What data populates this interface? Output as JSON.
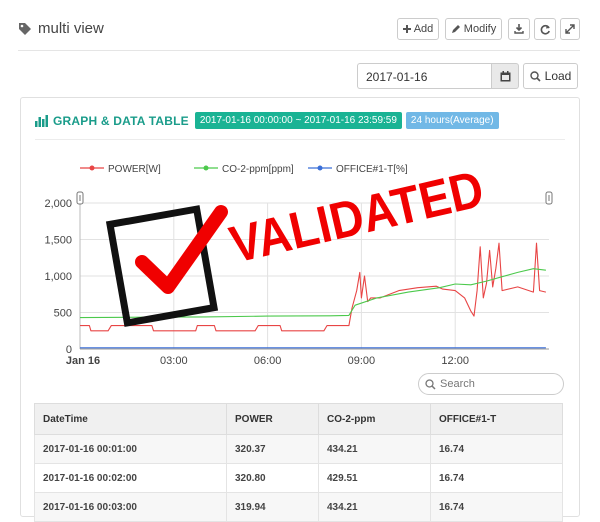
{
  "header": {
    "title": "multi view",
    "add_label": "Add",
    "modify_label": "Modify"
  },
  "toolbar": {
    "date_value": "2017-01-16",
    "load_label": "Load"
  },
  "panel": {
    "title": "GRAPH & DATA TABLE",
    "range_badge": "2017-01-16 00:00:00 ~ 2017-01-16 23:59:59",
    "mode_badge": "24 hours(Average)"
  },
  "search": {
    "placeholder": "Search"
  },
  "stamp": {
    "text": "VALIDATED"
  },
  "colors": {
    "accent": "#1ab394",
    "badge_blue": "#71b8e6",
    "power": "#e84545",
    "co2": "#4cc94c",
    "office": "#3a6fd8",
    "stamp": "#f00000"
  },
  "chart_data": {
    "type": "line",
    "legend": [
      "POWER[W]",
      "CO-2-ppm[ppm]",
      "OFFICE#1-T[%]"
    ],
    "x_ticks": [
      "Jan 16",
      "03:00",
      "06:00",
      "09:00",
      "12:00"
    ],
    "y_ticks": [
      "0",
      "500",
      "1,000",
      "1,500",
      "2,000"
    ],
    "ylim": [
      0,
      2000
    ],
    "xlim_hours": [
      0,
      15
    ],
    "series": [
      {
        "name": "POWER[W]",
        "color": "#e84545",
        "points": [
          [
            0,
            320
          ],
          [
            0.3,
            320
          ],
          [
            0.35,
            250
          ],
          [
            0.9,
            250
          ],
          [
            1.0,
            320
          ],
          [
            2.3,
            320
          ],
          [
            2.35,
            250
          ],
          [
            3.7,
            250
          ],
          [
            3.75,
            320
          ],
          [
            4.3,
            320
          ],
          [
            4.35,
            250
          ],
          [
            5.6,
            250
          ],
          [
            5.7,
            320
          ],
          [
            6.4,
            320
          ],
          [
            6.45,
            250
          ],
          [
            7.8,
            250
          ],
          [
            7.9,
            320
          ],
          [
            8.6,
            320
          ],
          [
            8.7,
            560
          ],
          [
            8.85,
            800
          ],
          [
            8.95,
            1050
          ],
          [
            9.0,
            700
          ],
          [
            9.1,
            1000
          ],
          [
            9.2,
            650
          ],
          [
            9.3,
            700
          ],
          [
            9.6,
            700
          ],
          [
            10.2,
            800
          ],
          [
            10.8,
            840
          ],
          [
            11.4,
            860
          ],
          [
            11.6,
            820
          ],
          [
            12.0,
            800
          ],
          [
            12.3,
            700
          ],
          [
            12.5,
            520
          ],
          [
            12.6,
            450
          ],
          [
            12.7,
            800
          ],
          [
            12.8,
            1400
          ],
          [
            12.9,
            700
          ],
          [
            13.0,
            900
          ],
          [
            13.1,
            1350
          ],
          [
            13.2,
            850
          ],
          [
            13.3,
            1100
          ],
          [
            13.4,
            1450
          ],
          [
            13.5,
            800
          ],
          [
            14.0,
            850
          ],
          [
            14.5,
            780
          ],
          [
            14.6,
            1450
          ],
          [
            14.7,
            800
          ],
          [
            14.9,
            780
          ]
        ]
      },
      {
        "name": "CO-2-ppm[ppm]",
        "color": "#4cc94c",
        "points": [
          [
            0,
            430
          ],
          [
            2,
            435
          ],
          [
            4,
            440
          ],
          [
            6,
            450
          ],
          [
            8,
            455
          ],
          [
            8.6,
            460
          ],
          [
            8.8,
            600
          ],
          [
            9.5,
            700
          ],
          [
            10.5,
            780
          ],
          [
            11.5,
            840
          ],
          [
            12,
            890
          ],
          [
            12.5,
            880
          ],
          [
            13,
            930
          ],
          [
            13.5,
            990
          ],
          [
            14,
            1050
          ],
          [
            14.5,
            1100
          ],
          [
            14.9,
            1080
          ]
        ]
      },
      {
        "name": "OFFICE#1-T[%]",
        "color": "#3a6fd8",
        "points": [
          [
            0,
            17
          ],
          [
            14.9,
            17
          ]
        ]
      }
    ]
  },
  "table": {
    "columns": [
      "DateTime",
      "POWER",
      "CO-2-ppm",
      "OFFICE#1-T"
    ],
    "rows": [
      [
        "2017-01-16 00:01:00",
        "320.37",
        "434.21",
        "16.74"
      ],
      [
        "2017-01-16 00:02:00",
        "320.80",
        "429.51",
        "16.74"
      ],
      [
        "2017-01-16 00:03:00",
        "319.94",
        "434.21",
        "16.74"
      ]
    ]
  }
}
